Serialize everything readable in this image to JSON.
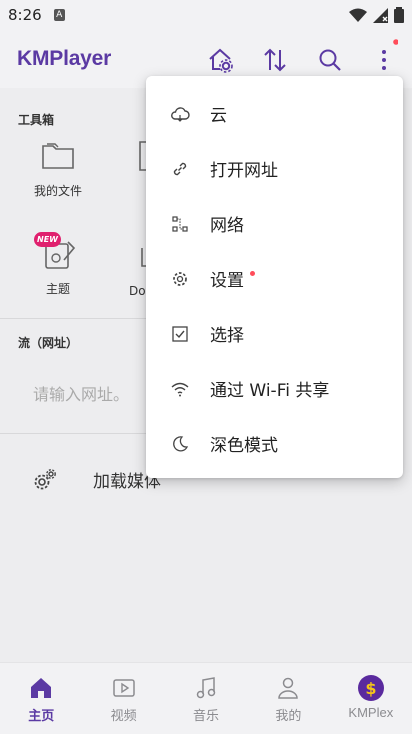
{
  "status": {
    "time": "8:26",
    "notif_badge": "A"
  },
  "appbar": {
    "logo": "KMPlayer"
  },
  "toolbox": {
    "title": "工具箱",
    "items": [
      {
        "label": "我的文件"
      },
      {
        "label": "主题",
        "badge": "NEW"
      }
    ],
    "partial_labels": [
      "Dov"
    ]
  },
  "stream": {
    "title": "流（网址）",
    "placeholder": "请输入网址。"
  },
  "load_media": {
    "label": "加载媒体"
  },
  "menu": {
    "items": [
      {
        "label": "云",
        "icon": "cloud-icon"
      },
      {
        "label": "打开网址",
        "icon": "link-icon"
      },
      {
        "label": "网络",
        "icon": "network-icon"
      },
      {
        "label": "设置",
        "icon": "gear-icon",
        "dot": true
      },
      {
        "label": "选择",
        "icon": "checkbox-icon"
      },
      {
        "label": "通过 Wi-Fi 共享",
        "icon": "wifi-icon"
      },
      {
        "label": "深色模式",
        "icon": "moon-icon"
      }
    ]
  },
  "nav": {
    "items": [
      {
        "label": "主页",
        "icon": "home-icon",
        "active": true
      },
      {
        "label": "视频",
        "icon": "video-icon"
      },
      {
        "label": "音乐",
        "icon": "music-icon"
      },
      {
        "label": "我的",
        "icon": "person-icon"
      },
      {
        "label": "KMPlex",
        "icon": "dollar-icon"
      }
    ]
  },
  "colors": {
    "accent": "#5b3aa3",
    "badge": "#e0206e",
    "kmplex": "#5a2a9e",
    "kmplex_glyph": "#f5c518"
  }
}
